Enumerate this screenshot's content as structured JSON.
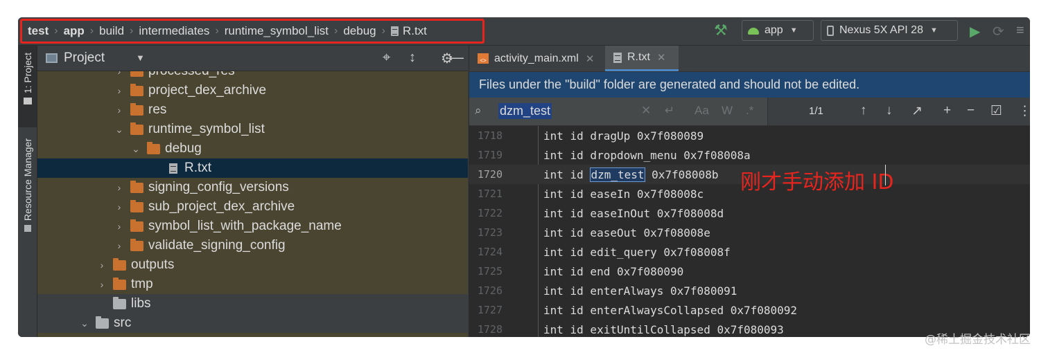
{
  "breadcrumb": {
    "items": [
      "test",
      "app",
      "build",
      "intermediates",
      "runtime_symbol_list",
      "debug",
      "R.txt"
    ]
  },
  "toolbar": {
    "module_combo": "app",
    "device_combo": "Nexus 5X API 28",
    "build_icon": "hammer-icon",
    "run_icon": "play-icon",
    "debug_icon": "debug-icon"
  },
  "stripe": {
    "project_tab": "1: Project",
    "resource_tab": "Resource Manager"
  },
  "project_panel": {
    "title": "Project",
    "tree": [
      {
        "label": "processed_res",
        "expanded": false
      },
      {
        "label": "project_dex_archive",
        "expanded": false
      },
      {
        "label": "res",
        "expanded": false
      },
      {
        "label": "runtime_symbol_list",
        "expanded": true
      },
      {
        "label": "debug",
        "expanded": true
      },
      {
        "label": "R.txt",
        "selected": true
      },
      {
        "label": "signing_config_versions",
        "expanded": false
      },
      {
        "label": "sub_project_dex_archive",
        "expanded": false
      },
      {
        "label": "symbol_list_with_package_name",
        "expanded": false
      },
      {
        "label": "validate_signing_config",
        "expanded": false
      },
      {
        "label": "outputs",
        "expanded": false
      },
      {
        "label": "tmp",
        "expanded": false
      },
      {
        "label": "libs"
      },
      {
        "label": "src",
        "expanded": true
      }
    ]
  },
  "editor": {
    "tabs": [
      {
        "label": "activity_main.xml",
        "active": false
      },
      {
        "label": "R.txt",
        "active": true
      }
    ],
    "notice": "Files under the \"build\" folder are generated and should not be edited.",
    "search": {
      "query": "dzm_test",
      "match_count": "1/1",
      "case_option": "Aa",
      "word_option": "W",
      "regex_option": ".*"
    },
    "lines": [
      {
        "num": "1718",
        "text": "int id dragUp 0x7f080089"
      },
      {
        "num": "1719",
        "text": "int id dropdown_menu 0x7f08008a"
      },
      {
        "num": "1720",
        "prefix": "int id ",
        "match": "dzm_test",
        "suffix": " 0x7f08008b"
      },
      {
        "num": "1721",
        "text": "int id easeIn 0x7f08008c"
      },
      {
        "num": "1722",
        "text": "int id easeInOut 0x7f08008d"
      },
      {
        "num": "1723",
        "text": "int id easeOut 0x7f08008e"
      },
      {
        "num": "1724",
        "text": "int id edit_query 0x7f08008f"
      },
      {
        "num": "1725",
        "text": "int id end 0x7f080090"
      },
      {
        "num": "1726",
        "text": "int id enterAlways 0x7f080091"
      },
      {
        "num": "1727",
        "text": "int id enterAlwaysCollapsed 0x7f080092"
      },
      {
        "num": "1728",
        "text": "int id exitUntilCollapsed 0x7f080093"
      }
    ],
    "annotation": "刚才手动添加 ID"
  },
  "watermark": "@稀土掘金技术社区",
  "colors": {
    "highlight_box": "#e8241e",
    "notice_bg": "#1e4670",
    "search_match_bg": "#1f3b62"
  }
}
